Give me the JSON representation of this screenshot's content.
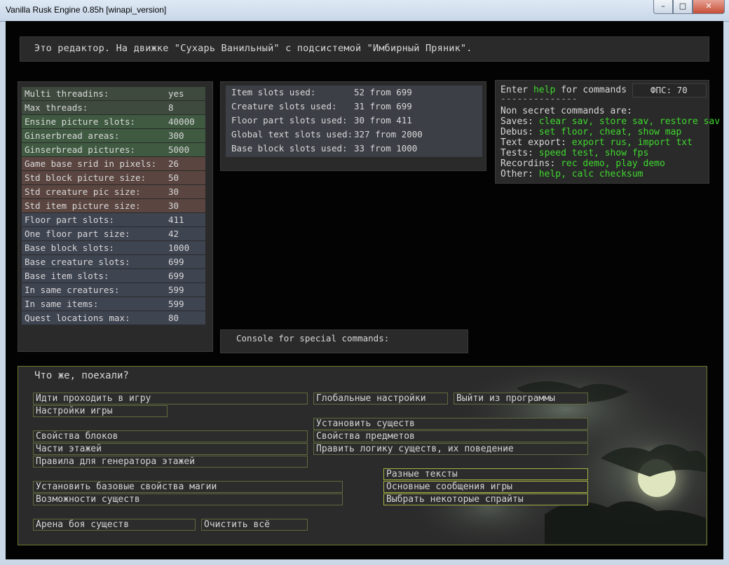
{
  "window": {
    "title": "Vanilla Rusk Engine 0.85h [winapi_version]",
    "min_glyph": "–",
    "max_glyph": "□",
    "close_glyph": "✕"
  },
  "header": {
    "text": "Это редактор. На движке \"Сухарь Ванильный\" с подсистемой \"Имбирный Пряник\"."
  },
  "config": [
    {
      "key": "Multi threadins:",
      "value": "yes",
      "color": "#3e4a3e"
    },
    {
      "key": "Max threads:",
      "value": "8",
      "color": "#3e4a3e"
    },
    {
      "key": "Ensine picture slots:",
      "value": "40000",
      "color": "#3f5a41"
    },
    {
      "key": "Ginserbread areas:",
      "value": "300",
      "color": "#3f5a41"
    },
    {
      "key": "Ginserbread pictures:",
      "value": "5000",
      "color": "#3f5a41"
    },
    {
      "key": "Game base srid in pixels:",
      "value": "26",
      "color": "#5a4540"
    },
    {
      "key": "Std block picture size:",
      "value": "50",
      "color": "#5a4540"
    },
    {
      "key": "Std creature pic size:",
      "value": "30",
      "color": "#5a4540"
    },
    {
      "key": "Std item picture size:",
      "value": "30",
      "color": "#5a4540"
    },
    {
      "key": "Floor part slots:",
      "value": "411",
      "color": "#3f4451"
    },
    {
      "key": "One floor part size:",
      "value": "42",
      "color": "#3f4451"
    },
    {
      "key": "Base block slots:",
      "value": "1000",
      "color": "#3f4451"
    },
    {
      "key": "Base creature slots:",
      "value": "699",
      "color": "#3f4451"
    },
    {
      "key": "Base item slots:",
      "value": "699",
      "color": "#3f4451"
    },
    {
      "key": "In same creatures:",
      "value": "599",
      "color": "#3f4451"
    },
    {
      "key": "In same items:",
      "value": "599",
      "color": "#3f4451"
    },
    {
      "key": "Quest locations max:",
      "value": "80",
      "color": "#3f4451"
    }
  ],
  "slots": [
    {
      "key": "Item slots used:",
      "value": "52 from 699"
    },
    {
      "key": "Creature slots used:",
      "value": "31 from 699"
    },
    {
      "key": "Floor part slots used:",
      "value": "30 from 411"
    },
    {
      "key": "Global text slots used:",
      "value": "327 from 2000"
    },
    {
      "key": "Base block slots used:",
      "value": "33 from 1000"
    }
  ],
  "commands": {
    "enter": "Enter",
    "help": "help",
    "for_commands": "for commands",
    "fps": "ФПС: 70",
    "separator": "--------------",
    "non_secret": "Non secret commands are:",
    "lines": [
      {
        "label": "Saves:",
        "cmds": "clear sav, store sav, restore sav"
      },
      {
        "label": "Debus:",
        "cmds": "set floor, cheat, show map"
      },
      {
        "label": "Text export:",
        "cmds": "export rus, import txt"
      },
      {
        "label": "Tests:",
        "cmds": "speed test, show fps"
      },
      {
        "label": "Recordins:",
        "cmds": "rec demo, play demo"
      },
      {
        "label": "Other:",
        "cmds": "help, calc checksum"
      }
    ]
  },
  "console": {
    "label": "Console for special commands:",
    "input_value": ""
  },
  "menu": {
    "prompt": "Что же, поехали?",
    "buttons": {
      "play": "Идти проходить в игру",
      "game_settings": "Настройки игры",
      "global_settings": "Глобальные настройки",
      "exit": "Выйти из программы",
      "place_creatures": "Установить существ",
      "block_props": "Свойства блоков",
      "item_props": "Свойства предметов",
      "floor_parts": "Части этажей",
      "creature_logic": "Править логику существ, их поведение",
      "floor_gen_rules": "Правила для генератора этажей",
      "misc_texts": "Разные тексты",
      "base_magic": "Установить базовые свойства магии",
      "game_messages": "Основные сообщения игры",
      "creature_abilities": "Возможности существ",
      "pick_sprites": "Выбрать некоторые спрайты",
      "arena": "Арена боя существ",
      "clear_all": "Очистить всё"
    }
  }
}
